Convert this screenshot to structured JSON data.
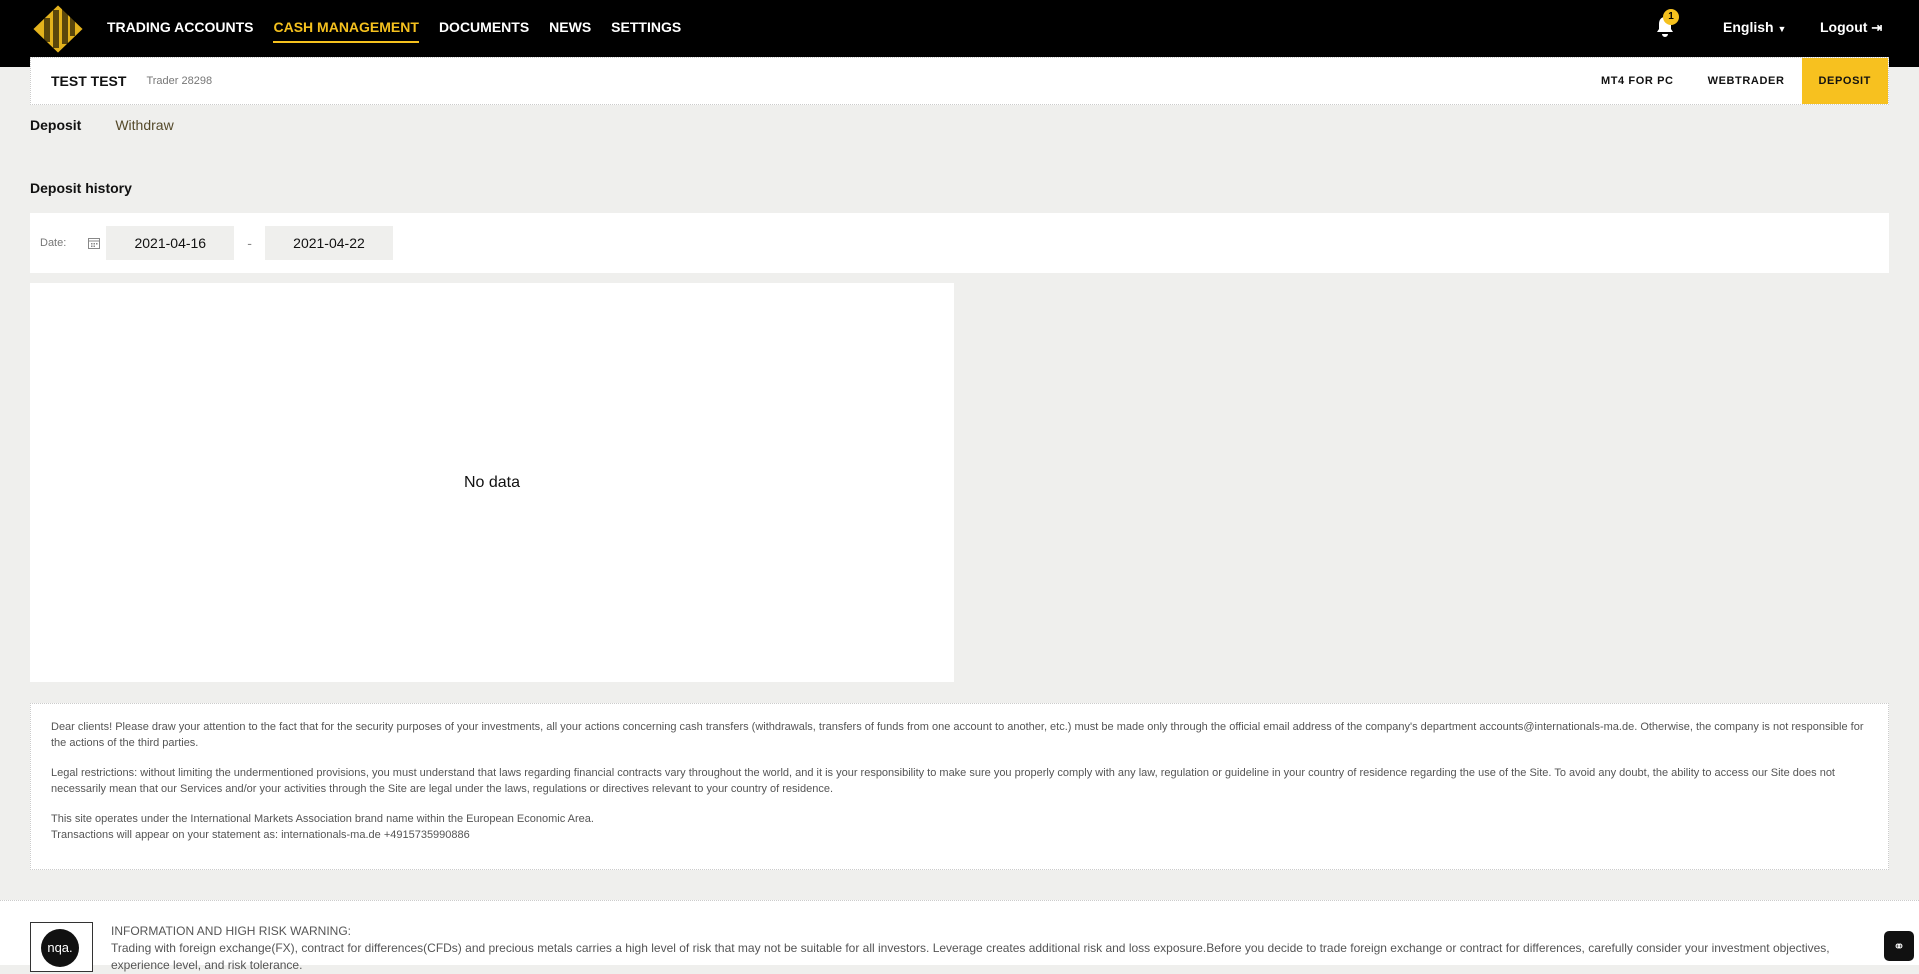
{
  "nav": {
    "items": [
      "TRADING ACCOUNTS",
      "CASH MANAGEMENT",
      "DOCUMENTS",
      "NEWS",
      "SETTINGS"
    ],
    "active": "CASH MANAGEMENT",
    "notification_count": "1",
    "language": "English",
    "logout": "Logout"
  },
  "account": {
    "name": "TEST TEST",
    "trader": "Trader 28298",
    "actions": [
      "MT4 FOR PC",
      "WEBTRADER",
      "DEPOSIT"
    ]
  },
  "tabs": [
    "Deposit",
    "Withdraw"
  ],
  "history": {
    "title": "Deposit history",
    "date_label": "Date:",
    "from": "2021-04-16",
    "separator": "-",
    "to": "2021-04-22",
    "empty": "No data"
  },
  "notice": [
    "Dear clients! Please draw your attention to the fact that for the security purposes of your investments, all your actions concerning cash transfers (withdrawals, transfers of funds from one account to another, etc.) must be made only through the official email address of the company's department accounts@internationals-ma.de. Otherwise, the company is not responsible for the actions of the third parties.",
    "Legal restrictions: without limiting the undermentioned provisions, you must understand that laws regarding financial contracts vary throughout the world, and it is your responsibility to make sure you properly comply with any law, regulation or guideline in your country of residence regarding the use of the Site. To avoid any doubt, the ability to access our Site does not necessarily mean that our Services and/or your activities through the Site are legal under the laws, regulations or directives relevant to your country of residence.",
    "This site operates under the International Markets Association brand name within the European Economic Area.",
    "Transactions will appear on your statement as: internationals-ma.de +4915735990886"
  ],
  "footer": {
    "logo_text": "nqa.",
    "heading": "INFORMATION AND HIGH RISK WARNING:",
    "text": "Trading with foreign exchange(FX), contract for differences(CFDs) and precious metals carries a high level of risk that may not be suitable for all investors. Leverage creates additional risk and loss exposure.Before you decide to trade foreign exchange or contract for differences, carefully consider your investment objectives, experience level, and risk tolerance."
  },
  "colors": {
    "accent": "#f7c11f",
    "topbar": "#000000",
    "background": "#efefed"
  }
}
